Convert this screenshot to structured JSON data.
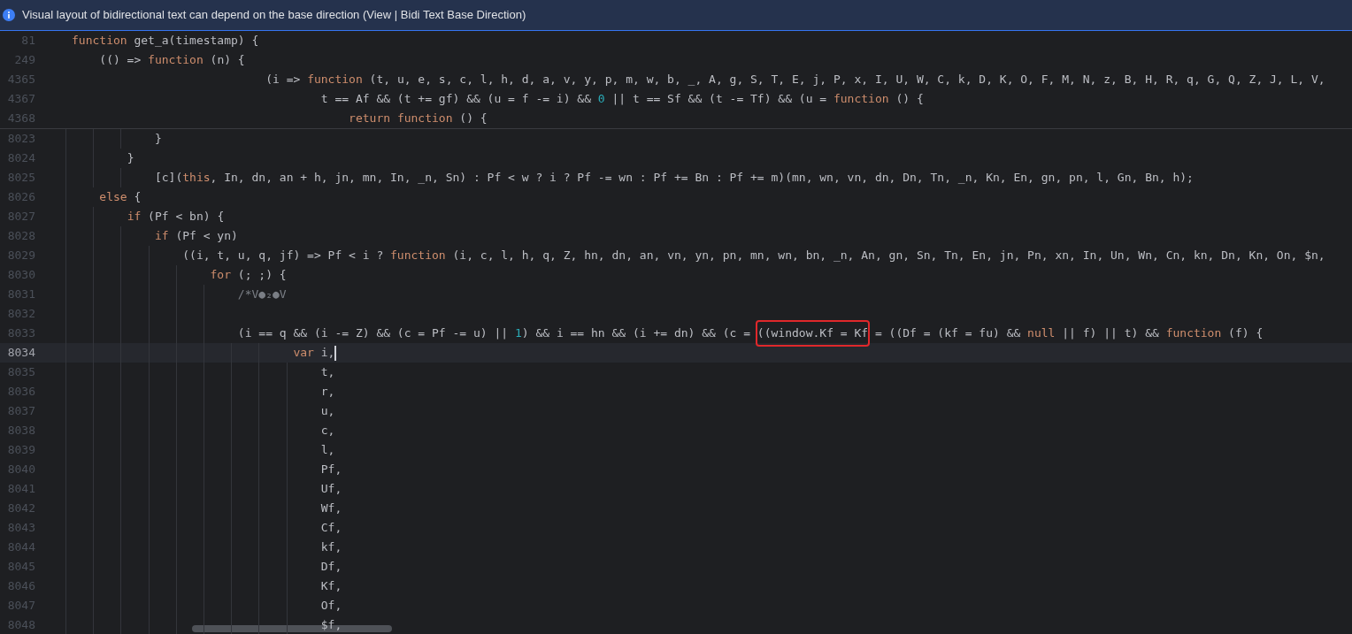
{
  "banner": {
    "text": "Visual layout of bidirectional text can depend on the base direction (View | Bidi Text Base Direction)"
  },
  "sticky_lines": [
    {
      "number": "81",
      "segments": [
        {
          "kind": "keyword",
          "text": "function"
        },
        {
          "kind": "plain",
          "text": " get_a(timestamp) {"
        }
      ]
    },
    {
      "number": "249",
      "segments": [
        {
          "kind": "plain",
          "text": "    (() => "
        },
        {
          "kind": "keyword",
          "text": "function"
        },
        {
          "kind": "plain",
          "text": " (n) {"
        }
      ]
    },
    {
      "number": "4365",
      "segments": [
        {
          "kind": "plain",
          "text": "                            (i => "
        },
        {
          "kind": "keyword",
          "text": "function"
        },
        {
          "kind": "plain",
          "text": " (t, u, e, s, c, l, h, d, a, v, y, p, m, w, b, _, A, g, S, T, E, j, P, x, I, U, W, C, k, D, K, O, F, M, N, z, B, H, R, q, G, Q, Z, J, L, V,"
        }
      ]
    },
    {
      "number": "4367",
      "segments": [
        {
          "kind": "plain",
          "text": "                                    t == Af && (t += gf) && (u = f -= i) && "
        },
        {
          "kind": "number",
          "text": "0"
        },
        {
          "kind": "plain",
          "text": " || t == Sf && (t -= Tf) && (u = "
        },
        {
          "kind": "keyword",
          "text": "function"
        },
        {
          "kind": "plain",
          "text": " () {"
        }
      ]
    },
    {
      "number": "4368",
      "segments": [
        {
          "kind": "keyword",
          "text": "                                        return"
        },
        {
          "kind": "keyword",
          "text": " function"
        },
        {
          "kind": "plain",
          "text": " () {"
        }
      ]
    }
  ],
  "lines": [
    {
      "number": "8023",
      "current": false,
      "segments": [
        {
          "kind": "plain",
          "text": "            }"
        }
      ]
    },
    {
      "number": "8024",
      "current": false,
      "segments": [
        {
          "kind": "plain",
          "text": "        }"
        }
      ]
    },
    {
      "number": "8025",
      "current": false,
      "segments": [
        {
          "kind": "plain",
          "text": "            [c]("
        },
        {
          "kind": "keyword",
          "text": "this"
        },
        {
          "kind": "plain",
          "text": ", In, dn, an + h, jn, mn, In, _n, Sn) : Pf < w ? i ? Pf -= wn : Pf += Bn : Pf += m)(mn, wn, vn, dn, Dn, Tn, _n, Kn, En, gn, pn, l, Gn, Bn, h);"
        }
      ]
    },
    {
      "number": "8026",
      "current": false,
      "segments": [
        {
          "kind": "keyword",
          "text": "    else"
        },
        {
          "kind": "plain",
          "text": " {"
        }
      ]
    },
    {
      "number": "8027",
      "current": false,
      "segments": [
        {
          "kind": "keyword",
          "text": "        if"
        },
        {
          "kind": "plain",
          "text": " (Pf < bn) {"
        }
      ]
    },
    {
      "number": "8028",
      "current": false,
      "segments": [
        {
          "kind": "keyword",
          "text": "            if"
        },
        {
          "kind": "plain",
          "text": " (Pf < yn)"
        }
      ]
    },
    {
      "number": "8029",
      "current": false,
      "segments": [
        {
          "kind": "plain",
          "text": "                ((i, t, u, q, jf) => Pf < i ? "
        },
        {
          "kind": "keyword",
          "text": "function"
        },
        {
          "kind": "plain",
          "text": " (i, c, l, h, q, Z, hn, dn, an, vn, yn, pn, mn, wn, bn, _n, An, gn, Sn, Tn, En, jn, Pn, xn, In, Un, Wn, Cn, kn, Dn, Kn, On, $n,"
        }
      ]
    },
    {
      "number": "8030",
      "current": false,
      "segments": [
        {
          "kind": "keyword",
          "text": "                    for"
        },
        {
          "kind": "plain",
          "text": " (; ;) {"
        }
      ]
    },
    {
      "number": "8031",
      "current": false,
      "segments": [
        {
          "kind": "comment",
          "text": "                        /*V●₂●V"
        }
      ]
    },
    {
      "number": "8032",
      "current": false
    },
    {
      "number": "8033",
      "current": false,
      "segments": [
        {
          "kind": "plain",
          "text": "                        (i == q && (i -= Z) && (c = Pf -= u) || "
        },
        {
          "kind": "number",
          "text": "1"
        },
        {
          "kind": "plain",
          "text": ") && i == hn && (i += dn) && (c = "
        },
        {
          "kind": "boxed",
          "text": "((window.Kf = Kf"
        },
        {
          "kind": "plain",
          "text": " = ((Df = (kf = fu) && "
        },
        {
          "kind": "keyword",
          "text": "null"
        },
        {
          "kind": "plain",
          "text": " || f) || t) && "
        },
        {
          "kind": "keyword",
          "text": "function"
        },
        {
          "kind": "plain",
          "text": " (f) {"
        }
      ]
    },
    {
      "number": "8034",
      "current": true,
      "segments": [
        {
          "kind": "keyword",
          "text": "                                var"
        },
        {
          "kind": "plain",
          "text": " i,"
        }
      ]
    },
    {
      "number": "8035",
      "current": false,
      "segments": [
        {
          "kind": "plain",
          "text": "                                    t,"
        }
      ]
    },
    {
      "number": "8036",
      "current": false,
      "segments": [
        {
          "kind": "plain",
          "text": "                                    r,"
        }
      ]
    },
    {
      "number": "8037",
      "current": false,
      "segments": [
        {
          "kind": "plain",
          "text": "                                    u,"
        }
      ]
    },
    {
      "number": "8038",
      "current": false,
      "segments": [
        {
          "kind": "plain",
          "text": "                                    c,"
        }
      ]
    },
    {
      "number": "8039",
      "current": false,
      "segments": [
        {
          "kind": "plain",
          "text": "                                    l,"
        }
      ]
    },
    {
      "number": "8040",
      "current": false,
      "segments": [
        {
          "kind": "plain",
          "text": "                                    Pf,"
        }
      ]
    },
    {
      "number": "8041",
      "current": false,
      "segments": [
        {
          "kind": "plain",
          "text": "                                    Uf,"
        }
      ]
    },
    {
      "number": "8042",
      "current": false,
      "segments": [
        {
          "kind": "plain",
          "text": "                                    Wf,"
        }
      ]
    },
    {
      "number": "8043",
      "current": false,
      "segments": [
        {
          "kind": "plain",
          "text": "                                    Cf,"
        }
      ]
    },
    {
      "number": "8044",
      "current": false,
      "segments": [
        {
          "kind": "plain",
          "text": "                                    kf,"
        }
      ]
    },
    {
      "number": "8045",
      "current": false,
      "segments": [
        {
          "kind": "plain",
          "text": "                                    Df,"
        }
      ]
    },
    {
      "number": "8046",
      "current": false,
      "segments": [
        {
          "kind": "plain",
          "text": "                                    Kf,"
        }
      ]
    },
    {
      "number": "8047",
      "current": false,
      "segments": [
        {
          "kind": "plain",
          "text": "                                    Of,"
        }
      ]
    },
    {
      "number": "8048",
      "current": false,
      "segments": [
        {
          "kind": "plain",
          "text": "                                    $f,"
        }
      ]
    }
  ]
}
